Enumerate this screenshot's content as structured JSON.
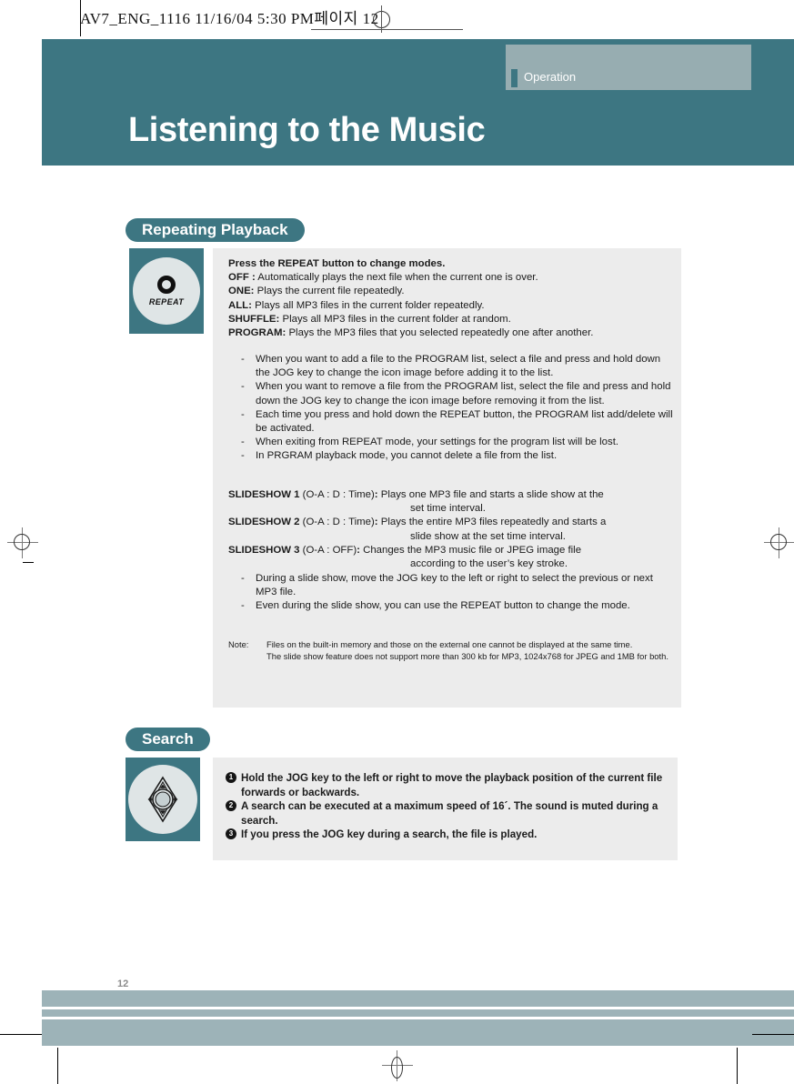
{
  "print_marks": {
    "filename_line": "AV7_ENG_1116  11/16/04  5:30 PM",
    "page_label_korean": "페이지",
    "page_label_number": "12"
  },
  "header": {
    "tab_label": "Operation",
    "title": "Listening to the Music",
    "bg_color": "#3d7682",
    "tab_bg_color": "#97adb1"
  },
  "sections": [
    {
      "badge": "Repeating Playback",
      "key_icon": "repeat-button-icon",
      "key_label": "REPEAT"
    },
    {
      "badge": "Search",
      "key_icon": "jog-key-icon"
    }
  ],
  "repeat": {
    "heading": "Press the REPEAT button to change modes.",
    "modes": [
      {
        "name": "OFF :",
        "desc": "Automatically plays the next file when the current one is over."
      },
      {
        "name": "ONE:",
        "desc": "Plays the current file repeatedly."
      },
      {
        "name": "ALL:",
        "desc": "Plays all MP3 files in the current folder repeatedly."
      },
      {
        "name": "SHUFFLE:",
        "desc": "Plays all MP3 files in the current folder at random."
      },
      {
        "name": "PROGRAM:",
        "desc": "Plays the MP3 files that you selected repeatedly one after another."
      }
    ],
    "program_bullets": [
      "When you want to add a file to the PROGRAM list, select a file and press and hold down the JOG key to change the icon image before adding it to the list.",
      "When you want to remove a file from the PROGRAM list, select the file and press and hold down the JOG key to change the icon image before removing it from the list.",
      "Each time you press and hold down the REPEAT button, the PROGRAM list add/delete will be activated.",
      "When exiting from REPEAT mode, your settings for the program list will be lost.",
      " In PRGRAM playback mode, you cannot delete a file from the list."
    ],
    "slideshows": [
      {
        "name": "SLIDESHOW 1",
        "params": "(O-A : D : Time)",
        "colon": ":",
        "desc_line1": "Plays one MP3 file and starts a slide show at the",
        "desc_line2": "set time interval."
      },
      {
        "name": "SLIDESHOW 2",
        "params": "(O-A : D : Time)",
        "colon": ":",
        "desc_line1": "Plays the entire MP3 files repeatedly and starts a",
        "desc_line2": "slide show at the set time interval."
      },
      {
        "name": "SLIDESHOW 3",
        "params": "(O-A : OFF)",
        "colon": ":",
        "desc_line1": "Changes the MP3 music file or JPEG image file",
        "desc_line2": "according to the user’s key stroke."
      }
    ],
    "slideshow_bullets": [
      "During a slide show, move the JOG key to the left or right to select the previous or next MP3 file.",
      "Even during the slide show, you can use the REPEAT button to change the mode."
    ],
    "note_label": "Note:",
    "notes": [
      "Files on the built-in memory and those on the external one cannot be displayed at the same time.",
      "The slide show feature does not support more than 300 kb for MP3, 1024x768 for JPEG and 1MB for both."
    ]
  },
  "search": {
    "items": [
      {
        "num": "1",
        "text": "Hold the JOG key to the left or right to move the playback position of the current file forwards or backwards."
      },
      {
        "num": "2",
        "text": " A search can be executed at a maximum speed of 16´. The sound is muted during a search."
      },
      {
        "num": "3",
        "text": " If you press the JOG key during a search, the file is played."
      }
    ]
  },
  "footer": {
    "page_number": "12",
    "bar_color": "#9db3b8"
  }
}
